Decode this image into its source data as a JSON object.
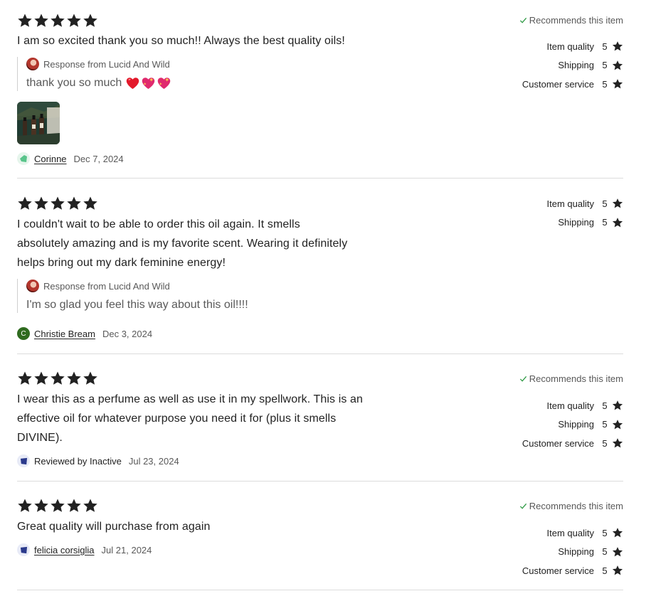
{
  "reviews": [
    {
      "rating": 5,
      "text_lines": [
        "I am so excited thank you so much!! Always the best quality oils!"
      ],
      "recommends": "Recommends this item",
      "response": {
        "header": "Response from Lucid And Wild",
        "text": "thank you so much"
      },
      "reviewer": "Corinne",
      "date": "Dec 7, 2024",
      "ratings": [
        {
          "label": "Item quality",
          "value": "5"
        },
        {
          "label": "Shipping",
          "value": "5"
        },
        {
          "label": "Customer service",
          "value": "5"
        }
      ]
    },
    {
      "rating": 5,
      "text_lines": [
        "I couldn't wait to be able to order this oil again. It smells",
        "absolutely amazing and is my favorite scent. Wearing it definitely",
        "helps bring out my dark feminine energy!"
      ],
      "response": {
        "header": "Response from Lucid And Wild",
        "text": "I'm so glad you feel this way about this oil!!!!"
      },
      "reviewer": "Christie Bream",
      "reviewer_initial": "C",
      "date": "Dec 3, 2024",
      "ratings": [
        {
          "label": "Item quality",
          "value": "5"
        },
        {
          "label": "Shipping",
          "value": "5"
        }
      ]
    },
    {
      "rating": 5,
      "text_lines": [
        "I wear this as a perfume as well as use it in my spellwork. This is an",
        "effective oil for whatever purpose you need it for (plus it smells",
        "DIVINE)."
      ],
      "recommends": "Recommends this item",
      "reviewer": "Reviewed by Inactive",
      "date": "Jul 23, 2024",
      "ratings": [
        {
          "label": "Item quality",
          "value": "5"
        },
        {
          "label": "Shipping",
          "value": "5"
        },
        {
          "label": "Customer service",
          "value": "5"
        }
      ]
    },
    {
      "rating": 5,
      "text_lines": [
        "Great quality will purchase from again"
      ],
      "recommends": "Recommends this item",
      "reviewer": "felicia corsiglia",
      "date": "Jul 21, 2024",
      "ratings": [
        {
          "label": "Item quality",
          "value": "5"
        },
        {
          "label": "Shipping",
          "value": "5"
        },
        {
          "label": "Customer service",
          "value": "5"
        }
      ]
    }
  ],
  "colors": {
    "star": "#222222",
    "check": "#2e9a44",
    "divider": "#dcdcdc",
    "muted_text": "#595959",
    "christie_avatar": "#2f6b1f",
    "inactive_avatar": "#2b3a8c",
    "corinne_avatar": "#58c48a"
  },
  "icons": {
    "star": "star-icon",
    "check": "check-icon",
    "heart": "sparkling-heart-icon"
  }
}
